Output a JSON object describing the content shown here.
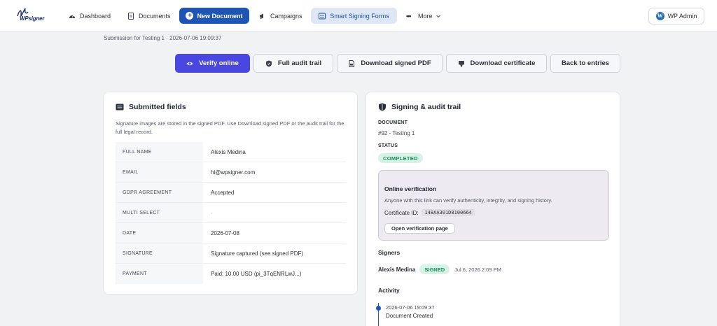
{
  "brand": {
    "logo_text": "WPsigner",
    "accent": "#1e55b4",
    "verify_color": "#4a46e0"
  },
  "nav": {
    "dashboard": "Dashboard",
    "documents": "Documents",
    "new_document": "New Document",
    "campaigns": "Campaigns",
    "smart_signing_forms": "Smart Signing Forms",
    "more": "More",
    "wp_admin": "WP Admin",
    "icons": [
      "dashboard-icon",
      "document-icon",
      "plus-circle-icon",
      "megaphone-icon",
      "form-icon",
      "ellipsis-icon",
      "chevron-down-icon",
      "wordpress-icon"
    ]
  },
  "subtitle": "Submission for Testing 1 · 2026-07-06 19:09:37",
  "actions": {
    "verify_online": "Verify online",
    "full_audit_trail": "Full audit trail",
    "download_signed_pdf": "Download signed PDF",
    "download_certificate": "Download certificate",
    "back_to_entries": "Back to entries"
  },
  "submitted": {
    "title": "Submitted fields",
    "note": "Signature images are stored in the signed PDF. Use Download signed PDF or the audit trail for the full legal record.",
    "rows": [
      {
        "key": "Full name",
        "value": "Alexis Medina"
      },
      {
        "key": "Email",
        "value": "hi@wpsigner.com"
      },
      {
        "key": "GDPR agreement",
        "value": "Accepted"
      },
      {
        "key": "Multi select",
        "value": "-"
      },
      {
        "key": "Date",
        "value": "2026-07-08"
      },
      {
        "key": "Signature",
        "value": "Signature captured (see signed PDF)"
      },
      {
        "key": "Payment",
        "value": "Paid: 10.00 USD (pi_3TqENRLwJ...)"
      }
    ]
  },
  "audit": {
    "title": "Signing & audit trail",
    "document_label": "DOCUMENT",
    "document_value": "#92 - Testing 1",
    "status_label": "STATUS",
    "status_value": "COMPLETED",
    "verification": {
      "title": "Online verification",
      "description": "Anyone with this link can verify authenticity, integrity, and signing history.",
      "cert_label": "Certificate ID:",
      "cert_id": "148AA301D8100664",
      "open_button": "Open verification page"
    },
    "signers_label": "Signers",
    "signer": {
      "name": "Alexis Medina",
      "status": "SIGNED",
      "date": "Jul 6, 2026 2:09 PM"
    },
    "activity_label": "Activity",
    "activity": {
      "timestamp": "2026-07-06 19:09:37",
      "event": "Document Created"
    }
  }
}
